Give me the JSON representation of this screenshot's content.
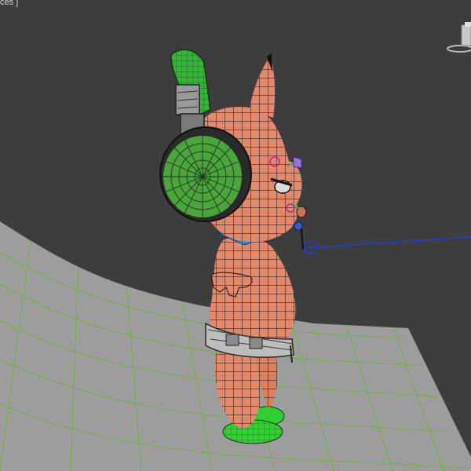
{
  "viewport": {
    "label_fragment": "ces ]"
  },
  "colors": {
    "background": "#3d3d3d",
    "floor": "#9a9a9a",
    "wireframe_grid": "#6fb33c",
    "skin": "#e28a6d",
    "mesh_line": "#1a0f0c",
    "headphone_green": "#37b23a",
    "headphone_dark": "#222222",
    "collar": "#1d8fe0",
    "belt": "#b9b9b9",
    "shoe_green": "#2fcf31",
    "bone_link": "#1b3fd8"
  },
  "icons": {
    "viewcube": "viewcube-icon",
    "character": "cartoon-character-mesh",
    "headphones": "headphones"
  }
}
